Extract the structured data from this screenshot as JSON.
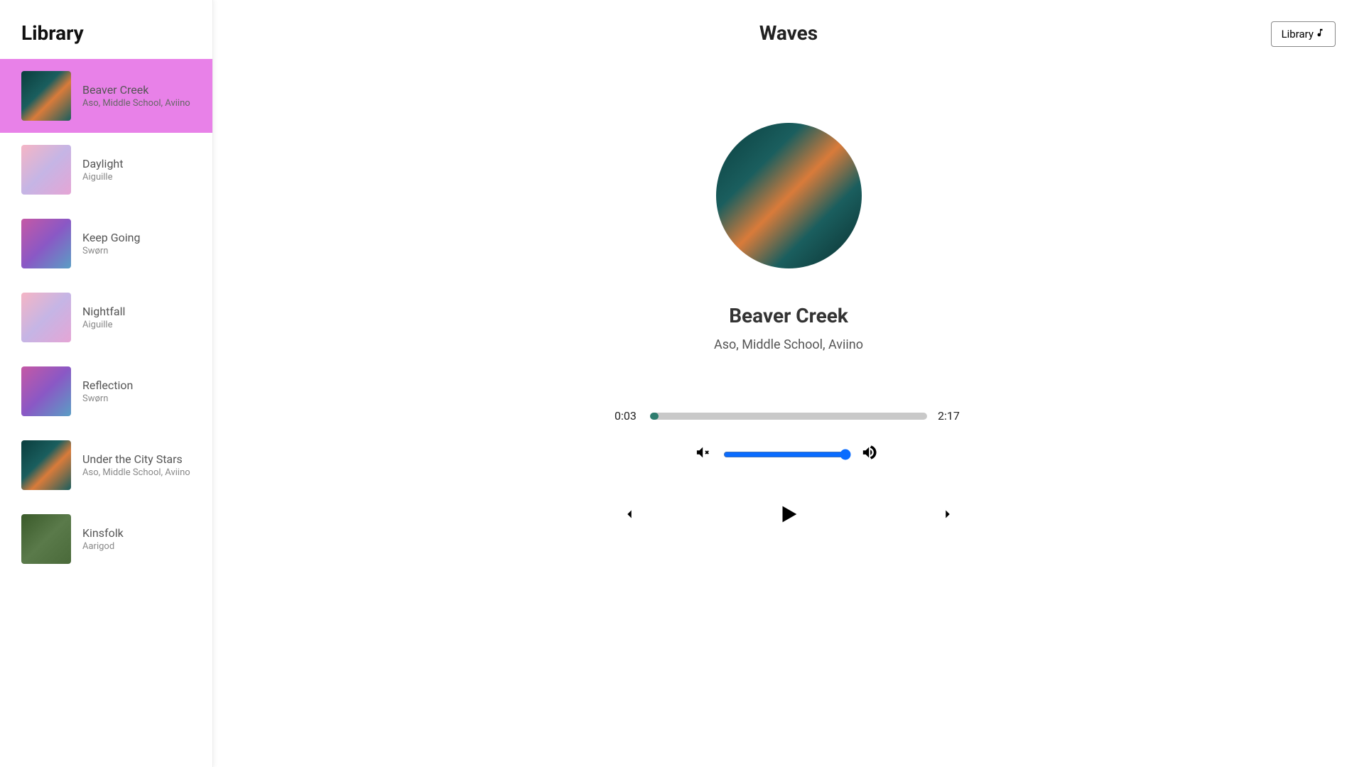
{
  "sidebar": {
    "title": "Library",
    "songs": [
      {
        "title": "Beaver Creek",
        "artist": "Aso, Middle School, Aviino",
        "thumb": "forest",
        "active": true
      },
      {
        "title": "Daylight",
        "artist": "Aiguille",
        "thumb": "pink",
        "active": false
      },
      {
        "title": "Keep Going",
        "artist": "Swørn",
        "thumb": "purple",
        "active": false
      },
      {
        "title": "Nightfall",
        "artist": "Aiguille",
        "thumb": "pink",
        "active": false
      },
      {
        "title": "Reflection",
        "artist": "Swørn",
        "thumb": "purple",
        "active": false
      },
      {
        "title": "Under the City Stars",
        "artist": "Aso, Middle School, Aviino",
        "thumb": "forest",
        "active": false
      },
      {
        "title": "Kinsfolk",
        "artist": "Aarigod",
        "thumb": "green",
        "active": false
      }
    ]
  },
  "header": {
    "app_title": "Waves",
    "library_btn": "Library"
  },
  "now_playing": {
    "title": "Beaver Creek",
    "artist": "Aso, Middle School, Aviino",
    "current_time": "0:03",
    "duration": "2:17",
    "progress_pct": 3,
    "volume": 100
  }
}
